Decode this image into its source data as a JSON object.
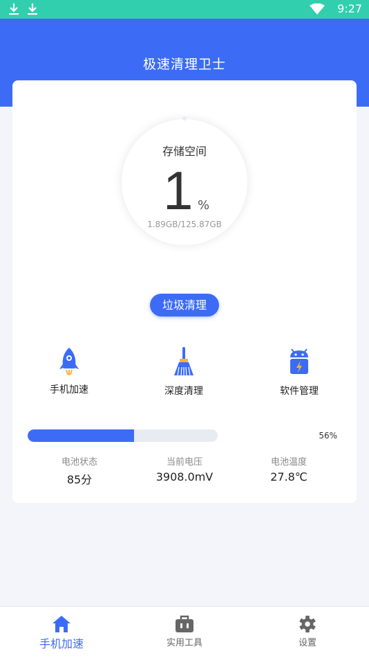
{
  "status_bar": {
    "time": "9:27"
  },
  "header": {
    "title": "极速清理卫士"
  },
  "storage": {
    "title": "存储空间",
    "percent": "1",
    "unit": "%",
    "size": "1.89GB/125.87GB"
  },
  "clean_button": {
    "label": "垃圾清理"
  },
  "features": [
    {
      "label": "手机加速",
      "icon": "rocket-icon"
    },
    {
      "label": "深度清理",
      "icon": "broom-icon"
    },
    {
      "label": "软件管理",
      "icon": "android-battery-icon"
    }
  ],
  "battery": {
    "level": 0.56,
    "level_text": "56%",
    "stats": [
      {
        "label": "电池状态",
        "value": "85分"
      },
      {
        "label": "当前电压",
        "value": "3908.0mV"
      },
      {
        "label": "电池温度",
        "value": "27.8℃"
      }
    ]
  },
  "nav": [
    {
      "label": "手机加速",
      "icon": "home-icon",
      "active": true
    },
    {
      "label": "实用工具",
      "icon": "toolbox-icon",
      "active": false
    },
    {
      "label": "设置",
      "icon": "gear-icon",
      "active": false
    }
  ],
  "colors": {
    "accent": "#3c6cf6",
    "status_bar": "#31cfae",
    "background": "#f3f5fa"
  }
}
